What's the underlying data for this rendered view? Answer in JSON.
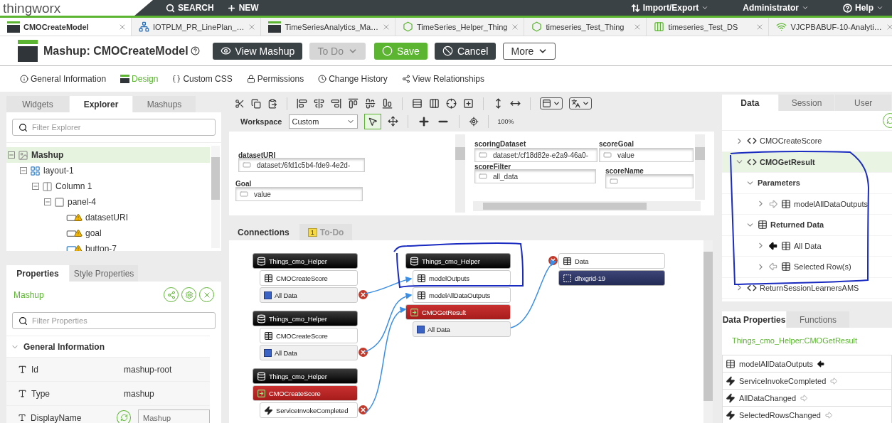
{
  "header": {
    "logo": "thingworx",
    "menu": [
      {
        "label": "SEARCH",
        "kind": "search"
      },
      {
        "label": "NEW",
        "kind": "new"
      }
    ],
    "account": [
      {
        "label": "Import/Export",
        "kind": "transfer"
      },
      {
        "label": "Administrator",
        "kind": "user"
      },
      {
        "label": "Help",
        "kind": "help"
      }
    ]
  },
  "tabs": [
    {
      "label": "CMOCreateModel",
      "kind": "mashup",
      "selected": true
    },
    {
      "label": "IOTPLM_PR_LinePlan_…",
      "kind": "network",
      "selected": false
    },
    {
      "label": "TimeSeriesAnalytics_Ma…",
      "kind": "mashup",
      "selected": false
    },
    {
      "label": "TimeSeries_Helper_Thing",
      "kind": "thing",
      "selected": false
    },
    {
      "label": "timeseries_Test_Thing",
      "kind": "thing",
      "selected": false
    },
    {
      "label": "timeseries_Test_DS",
      "kind": "datashape",
      "selected": false
    },
    {
      "label": "VJCPBABUF-10-Analyti…",
      "kind": "remote",
      "selected": false
    }
  ],
  "title": "Mashup: CMOCreateModel",
  "actions": [
    {
      "label": "View Mashup",
      "kind": "view",
      "disabled": false
    },
    {
      "label": "To Do",
      "kind": "todo",
      "disabled": true
    },
    {
      "label": "Save",
      "kind": "save",
      "disabled": false
    },
    {
      "label": "Cancel",
      "kind": "cancel",
      "disabled": false
    },
    {
      "label": "More",
      "kind": "more",
      "disabled": false
    }
  ],
  "nav": [
    {
      "label": "General Information",
      "kind": "info",
      "selected": false
    },
    {
      "label": "Design",
      "kind": "design",
      "selected": true
    },
    {
      "label": "Custom CSS",
      "kind": "css",
      "selected": false
    },
    {
      "label": "Permissions",
      "kind": "lock",
      "selected": false
    },
    {
      "label": "Change History",
      "kind": "history",
      "selected": false
    },
    {
      "label": "View Relationships",
      "kind": "relations",
      "selected": false
    }
  ],
  "explorer": {
    "tabs": [
      {
        "label": "Widgets",
        "selected": false
      },
      {
        "label": "Explorer",
        "selected": true
      },
      {
        "label": "Mashups",
        "selected": false
      }
    ],
    "filter_placeholder": "Filter Explorer",
    "tree": [
      {
        "label": "Mashup",
        "kind": "mashup",
        "selected": true,
        "expanded": true,
        "warning": false,
        "children": [
          {
            "label": "layout-1",
            "kind": "layout",
            "selected": false,
            "expanded": true,
            "warning": false,
            "children": [
              {
                "label": "Column 1",
                "kind": "column",
                "selected": false,
                "expanded": true,
                "warning": false,
                "children": [
                  {
                    "label": "panel-4",
                    "kind": "panel",
                    "selected": false,
                    "expanded": true,
                    "warning": false,
                    "children": [
                      {
                        "label": "datasetURI",
                        "kind": "textbox",
                        "selected": false,
                        "warning": true
                      },
                      {
                        "label": "goal",
                        "kind": "textbox",
                        "selected": false,
                        "warning": true
                      },
                      {
                        "label": "button-7",
                        "kind": "button",
                        "selected": false,
                        "warning": true
                      }
                    ]
                  }
                ]
              }
            ]
          }
        ]
      }
    ]
  },
  "properties": {
    "tabs": [
      {
        "label": "Properties",
        "selected": true
      },
      {
        "label": "Style Properties",
        "selected": false
      }
    ],
    "selection": "Mashup",
    "filter_placeholder": "Filter Properties",
    "section": {
      "label": "General Information",
      "expanded": true
    },
    "rows": [
      {
        "name": "Id",
        "value": "mashup-root",
        "kind": "text"
      },
      {
        "name": "Type",
        "value": "mashup",
        "kind": "text"
      },
      {
        "name": "DisplayName",
        "value": "Mashup",
        "kind": "input"
      }
    ]
  },
  "toolbar": {
    "workspace_label": "Workspace",
    "workspace": "Custom",
    "zoom": "100%"
  },
  "canvas": {
    "widgets": [
      {
        "label": "datasetURI",
        "value": "dataset:/6fd1c5b4-fde9-4e2d-"
      },
      {
        "label": "Goal",
        "value": "value"
      }
    ],
    "panel": [
      {
        "label": "scoringDataset",
        "value": "dataset:/cf18d82e-e2a9-46a0-"
      },
      {
        "label": "scoreGoal",
        "value": "value"
      },
      {
        "label": "scoreFilter",
        "value": "all_data"
      },
      {
        "label": "scoreName"
      }
    ]
  },
  "bottom_tabs": [
    {
      "label": "Connections",
      "selected": true
    },
    {
      "label": "To-Do",
      "badge": "1",
      "selected": false
    }
  ],
  "diagram": {
    "columns": [
      {
        "groups": [
          {
            "rows": [
              {
                "label": "Things_cmo_Helper",
                "kind": "thing",
                "remove": false
              },
              {
                "label": "CMOCreateScore",
                "kind": "table",
                "remove": false
              },
              {
                "label": "All Data",
                "kind": "data",
                "remove": true
              }
            ]
          },
          {
            "rows": [
              {
                "label": "Things_cmo_Helper",
                "kind": "thing",
                "remove": false
              },
              {
                "label": "CMOCreateScore",
                "kind": "table",
                "remove": false
              },
              {
                "label": "All Data",
                "kind": "data",
                "remove": true
              }
            ]
          },
          {
            "rows": [
              {
                "label": "Things_cmo_Helper",
                "kind": "thing",
                "remove": false
              },
              {
                "label": "CMOCreateScore",
                "kind": "service",
                "remove": false
              },
              {
                "label": "ServiceInvokeCompleted",
                "kind": "event",
                "remove": true
              }
            ]
          }
        ]
      },
      {
        "groups": [
          {
            "rows": [
              {
                "label": "Things_cmo_Helper",
                "kind": "thing",
                "remove": false
              },
              {
                "label": "modelOutputs",
                "kind": "table",
                "remove": false
              },
              {
                "label": "modelAllDataOutputs",
                "kind": "table",
                "remove": false
              },
              {
                "label": "CMOGetResult",
                "kind": "service",
                "remove": false
              },
              {
                "label": "All Data",
                "kind": "data",
                "remove": false
              }
            ]
          }
        ]
      },
      {
        "groups": [
          {
            "rows": [
              {
                "label": "Data",
                "kind": "table",
                "remove": true
              },
              {
                "label": "dhxgrid-19",
                "kind": "widget",
                "remove": false
              }
            ]
          }
        ]
      }
    ]
  },
  "data_panel": {
    "tabs": [
      {
        "label": "Data",
        "selected": true
      },
      {
        "label": "Session",
        "selected": false
      },
      {
        "label": "User",
        "selected": false
      }
    ],
    "tree": [
      {
        "label": "CMOCreateScore",
        "kind": "service",
        "expanded": false,
        "selected": false
      },
      {
        "label": "CMOGetResult",
        "kind": "service",
        "expanded": true,
        "selected": true,
        "children": [
          {
            "label": "Parameters",
            "kind": "group",
            "expanded": true,
            "selected": false,
            "children": [
              {
                "label": "modelAllDataOutputs",
                "kind": "param",
                "expanded": false,
                "selected": false
              }
            ]
          },
          {
            "label": "Returned Data",
            "kind": "returned",
            "expanded": true,
            "selected": false,
            "children": [
              {
                "label": "All Data",
                "kind": "all_data",
                "expanded": false,
                "selected": false
              },
              {
                "label": "Selected Row(s)",
                "kind": "selected_rows",
                "expanded": false,
                "selected": false
              }
            ]
          }
        ]
      },
      {
        "label": "ReturnSessionLearnersAMS",
        "kind": "service",
        "expanded": false,
        "selected": false
      }
    ]
  },
  "data_properties": {
    "tabs": [
      {
        "label": "Data Properties",
        "selected": true
      },
      {
        "label": "Functions",
        "selected": false
      }
    ],
    "source": "Things_cmo_Helper:CMOGetResult",
    "rows": [
      {
        "label": "modelAllDataOutputs",
        "kind": "input"
      },
      {
        "label": "ServiceInvokeCompleted",
        "kind": "event"
      },
      {
        "label": "AllDataChanged",
        "kind": "event"
      },
      {
        "label": "SelectedRowsChanged",
        "kind": "event"
      }
    ]
  }
}
